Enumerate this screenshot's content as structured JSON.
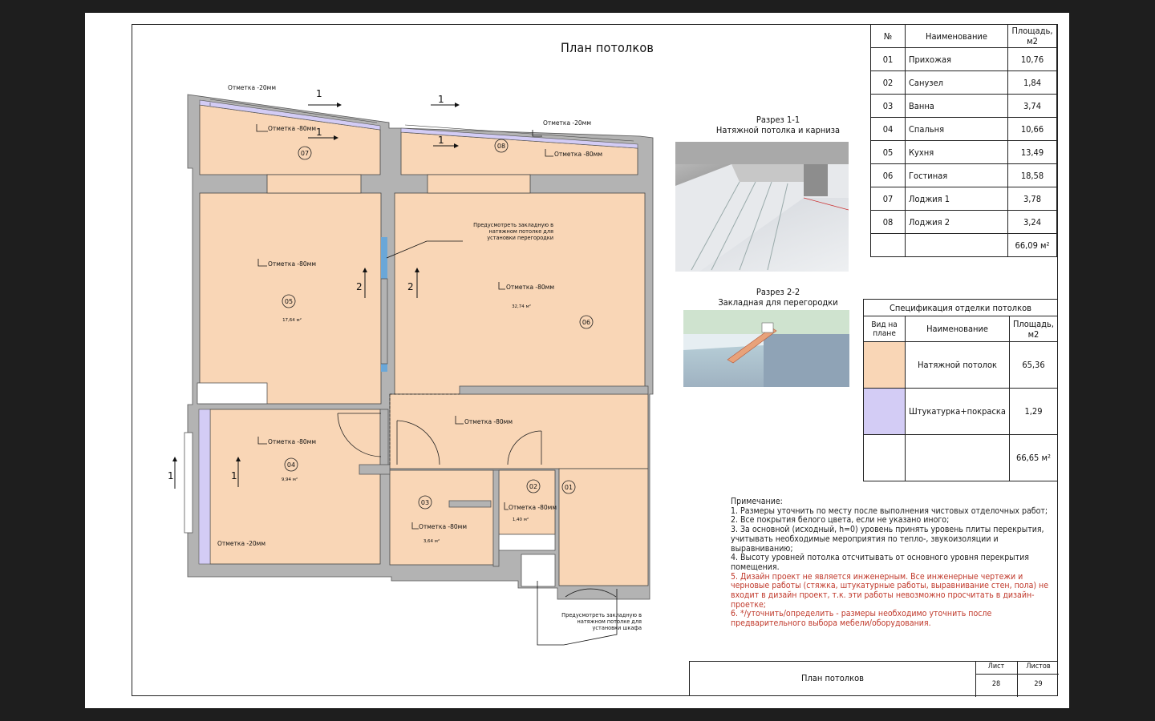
{
  "title": "План потолков",
  "plan": {
    "elevations": {
      "m20": "Отметка -20мм",
      "m80": "Отметка -80мм"
    },
    "room_numbers": [
      "07",
      "08",
      "05",
      "06",
      "04",
      "03",
      "02",
      "01"
    ],
    "room_areas": {
      "r05": "17,64 м²",
      "r06": "32,74 м²",
      "r04": "9,94 м²",
      "r03": "3,64 м²",
      "r02": "1,40 м²"
    },
    "section_marks": [
      "1",
      "1",
      "1",
      "1",
      "2",
      "2",
      "1",
      "1"
    ],
    "callout_partition": "Предусмотреть закладную в натяжном потолке для установки перегородки",
    "callout_wardrobe": "Предусмотреть закладную в натяжном потолке для установки шкафа"
  },
  "section1": {
    "title": "Разрез 1-1",
    "subtitle": "Натяжной потолка и карниза"
  },
  "section2": {
    "title": "Разрез 2-2",
    "subtitle": "Закладная для перегородки"
  },
  "rooms_table": {
    "headers": [
      "№",
      "Наименование",
      "Площадь, м2"
    ],
    "rows": [
      {
        "num": "01",
        "name": "Прихожая",
        "area": "10,76"
      },
      {
        "num": "02",
        "name": "Санузел",
        "area": "1,84"
      },
      {
        "num": "03",
        "name": "Ванна",
        "area": "3,74"
      },
      {
        "num": "04",
        "name": "Спальня",
        "area": "10,66"
      },
      {
        "num": "05",
        "name": "Кухня",
        "area": "13,49"
      },
      {
        "num": "06",
        "name": "Гостиная",
        "area": "18,58"
      },
      {
        "num": "07",
        "name": "Лоджия 1",
        "area": "3,78"
      },
      {
        "num": "08",
        "name": "Лоджия 2",
        "area": "3,24"
      }
    ],
    "total": "66,09 м²"
  },
  "spec_table": {
    "title": "Спецификация отделки потолков",
    "headers": [
      "Вид на плане",
      "Наименование",
      "Площадь, м2"
    ],
    "rows": [
      {
        "swatch": "#f9d6b6",
        "name": "Натяжной потолок",
        "area": "65,36"
      },
      {
        "swatch": "#d3ccf5",
        "name": "Штукатурка+покраска",
        "area": "1,29"
      }
    ],
    "total": "66,65 м²"
  },
  "notes": {
    "heading": "Примечание:",
    "lines": [
      "1. Размеры уточнить по месту после выполнения чистовых отделочных работ;",
      "2. Все покрытия белого цвета, если не указано иного;",
      "3. За основной (исходный, h=0) уровень принять уровень плиты перекрытия, учитывать необходимые мероприятия по тепло-, звукоизоляции и выравниванию;",
      "4. Высоту уровней потолка отсчитывать от основного уровня перекрытия помещения."
    ],
    "red_lines": [
      "5. Дизайн проект не является инженерным. Все инженерные чертежи и черновые работы (стяжка, штукатурные работы, выравнивание стен, пола) не входит в дизайн проект, т.к. эти работы невозможно просчитать в дизайн-проетке;",
      "6.  */уточнить/определить - размеры необходимо уточнить после предварительного выбора мебели/оборудования."
    ]
  },
  "stamp": {
    "name": "План потолков",
    "sheet_label": "Лист",
    "sheets_label": "Листов",
    "sheet": "28",
    "sheets": "29"
  },
  "colors": {
    "ceiling_fill": "#f9d6b6",
    "plaster_fill": "#d3ccf5",
    "wall_fill": "#b3b3b3",
    "note_red": "#c0392b"
  }
}
